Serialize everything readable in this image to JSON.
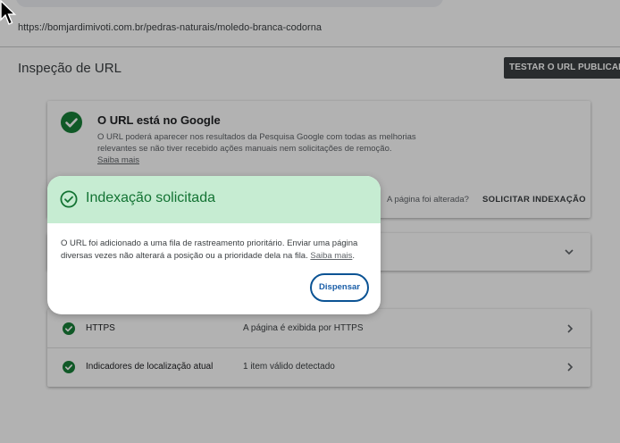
{
  "url": "https://bomjardimivoti.com.br/pedras-naturais/moledo-branca-codorna",
  "page_title": "Inspeção de URL",
  "test_button_label": "TESTAR O URL PUBLICADO",
  "status_card": {
    "title": "O URL está no Google",
    "description": "O URL poderá aparecer nos resultados da Pesquisa Google com todas as melhorias relevantes se não tiver recebido ações manuais nem solicitações de remoção.",
    "learn_more": "Saiba mais",
    "changed_question": "A página foi alterada?",
    "request_indexing_label": "SOLICITAR INDEXAÇÃO"
  },
  "enhancements": {
    "rows": [
      {
        "label": "HTTPS",
        "value": "A página é exibida por HTTPS"
      },
      {
        "label": "Indicadores de localização atual",
        "value": "1 item válido detectado"
      }
    ]
  },
  "dialog": {
    "title": "Indexação solicitada",
    "body": "O URL foi adicionado a uma fila de rastreamento prioritário. Enviar uma página diversas vezes não alterará a posição ou a prioridade dela na fila.",
    "learn_more": "Saiba mais",
    "dismiss_label": "Dispensar"
  },
  "colors": {
    "success_green": "#137333",
    "dialog_header_bg": "#c6ecd2",
    "primary_blue": "#1a5ea8",
    "dark_button": "#3c4043"
  },
  "icons": {
    "status": "check-circle-icon",
    "row_status": "check-circle-icon",
    "expand": "chevron-down-icon",
    "open_row": "chevron-right-icon",
    "dialog": "check-circle-outline-icon",
    "pointer": "mouse-cursor-icon"
  }
}
